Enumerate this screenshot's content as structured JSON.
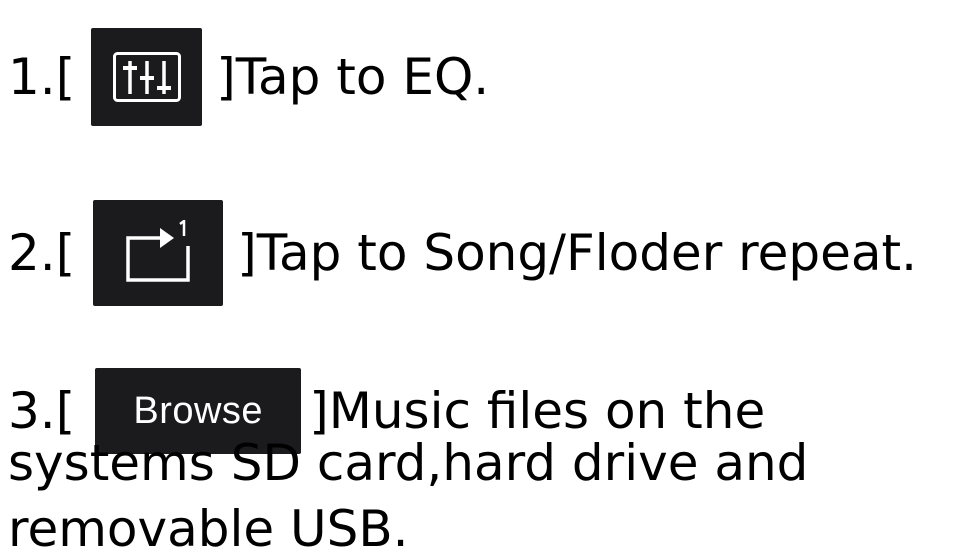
{
  "items": [
    {
      "prefix": "1.[",
      "icon": "eq-sliders-icon",
      "suffix": "]Tap to EQ."
    },
    {
      "prefix": "2.[",
      "icon": "repeat-one-icon",
      "suffix": "]Tap to Song/Floder repeat."
    },
    {
      "prefix": "3.[",
      "button_label": "Browse",
      "suffix": "]Music files on the",
      "continuation": [
        "systems SD card,hard drive and",
        "removable USB."
      ]
    }
  ],
  "colors": {
    "button_bg": "#1b1b1d",
    "button_fg": "#ffffff",
    "text": "#000000",
    "page_bg": "#ffffff"
  }
}
